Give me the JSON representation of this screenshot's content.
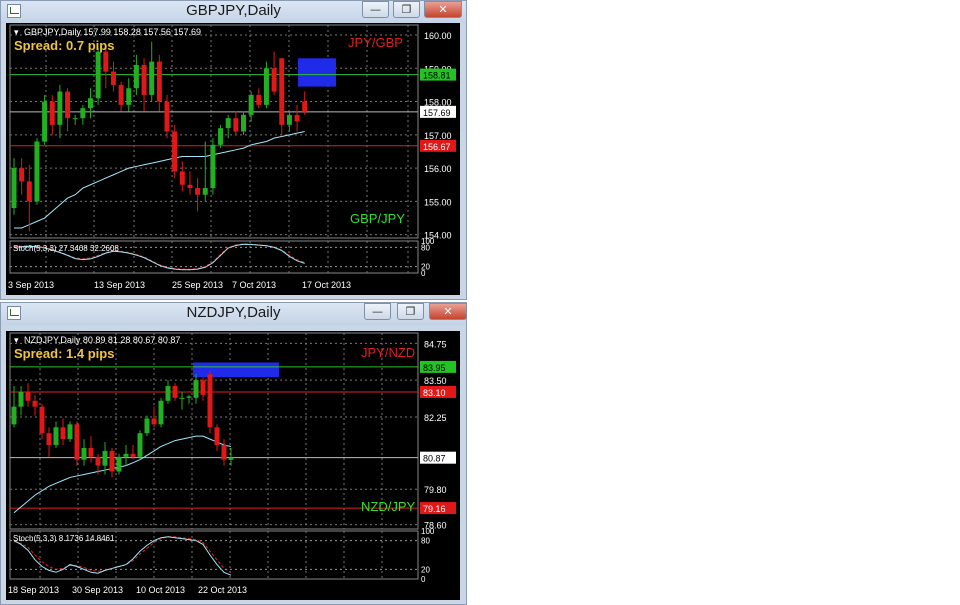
{
  "windows": [
    {
      "id": "gbpjpy",
      "title": "GBPJPY,Daily",
      "buttons": {
        "minimize": "—",
        "maximize": "❐",
        "close": "✕"
      },
      "header": "GBPJPY,Daily  157.99 158.28 157.56 157.69",
      "spread": "Spread: 0.7 pips",
      "label_red": "JPY/GBP",
      "label_green": "GBP/JPY",
      "price_levels": [
        "160.00",
        "159.00",
        "158.00",
        "157.00",
        "156.00",
        "155.00",
        "154.00"
      ],
      "ymin": 153.9,
      "ymax": 160.3,
      "green_line": {
        "value": 158.81,
        "label": "158.81"
      },
      "red_line": {
        "value": 156.67,
        "label": "156.67"
      },
      "current": {
        "value": 157.69,
        "label": "157.69"
      },
      "stoch_label": "Stoch(5,3,3) 27.3408 32.2608",
      "stoch_ticks": [
        "100",
        "80",
        "20",
        "0"
      ],
      "dates": [
        "3 Sep 2013",
        "13 Sep 2013",
        "25 Sep 2013",
        "7 Oct 2013",
        "17 Oct 2013"
      ],
      "candles": [
        [
          154.8,
          156.3,
          154.6,
          156.0
        ],
        [
          156.0,
          156.3,
          155.2,
          155.6
        ],
        [
          155.6,
          156.1,
          154.1,
          155.0
        ],
        [
          155.0,
          156.9,
          154.9,
          156.8
        ],
        [
          156.8,
          158.2,
          156.7,
          158.0
        ],
        [
          158.0,
          158.2,
          157.0,
          157.3
        ],
        [
          157.3,
          158.5,
          156.9,
          158.3
        ],
        [
          158.3,
          158.4,
          157.1,
          157.5
        ],
        [
          157.5,
          157.6,
          157.3,
          157.5
        ],
        [
          157.5,
          157.9,
          157.3,
          157.8
        ],
        [
          157.8,
          158.4,
          157.5,
          158.1
        ],
        [
          158.1,
          159.6,
          157.9,
          159.5
        ],
        [
          159.5,
          159.6,
          158.4,
          158.9
        ],
        [
          158.9,
          159.2,
          158.3,
          158.5
        ],
        [
          158.5,
          158.6,
          157.7,
          157.9
        ],
        [
          157.9,
          158.7,
          157.7,
          158.4
        ],
        [
          158.4,
          159.4,
          158.2,
          159.1
        ],
        [
          159.1,
          159.3,
          157.7,
          158.2
        ],
        [
          158.2,
          159.8,
          158.0,
          159.2
        ],
        [
          159.2,
          159.4,
          157.7,
          158.0
        ],
        [
          158.0,
          158.2,
          156.9,
          157.1
        ],
        [
          157.1,
          157.3,
          155.7,
          155.9
        ],
        [
          155.9,
          156.2,
          155.3,
          155.5
        ],
        [
          155.5,
          155.9,
          155.2,
          155.4
        ],
        [
          155.4,
          155.7,
          154.7,
          155.2
        ],
        [
          155.2,
          156.8,
          155.0,
          155.4
        ],
        [
          155.4,
          156.9,
          155.2,
          156.7
        ],
        [
          156.7,
          157.3,
          156.6,
          157.2
        ],
        [
          157.2,
          157.6,
          156.9,
          157.5
        ],
        [
          157.5,
          157.7,
          157.0,
          157.1
        ],
        [
          157.1,
          157.7,
          157.0,
          157.6
        ],
        [
          157.6,
          158.3,
          157.4,
          158.2
        ],
        [
          158.2,
          158.4,
          157.8,
          157.9
        ],
        [
          157.9,
          159.2,
          157.8,
          159.0
        ],
        [
          159.0,
          159.5,
          158.2,
          158.3
        ],
        [
          159.3,
          159.3,
          157.0,
          157.3
        ],
        [
          157.3,
          157.7,
          157.1,
          157.6
        ],
        [
          157.6,
          157.9,
          157.1,
          157.4
        ],
        [
          158.0,
          158.3,
          157.6,
          157.69
        ]
      ],
      "ma": [
        154.2,
        154.2,
        154.3,
        154.4,
        154.5,
        154.7,
        154.9,
        155.1,
        155.2,
        155.4,
        155.5,
        155.6,
        155.7,
        155.8,
        155.9,
        156.0,
        156.05,
        156.1,
        156.15,
        156.2,
        156.25,
        156.3,
        156.35,
        156.35,
        156.35,
        156.35,
        156.4,
        156.45,
        156.5,
        156.55,
        156.6,
        156.7,
        156.75,
        156.8,
        156.9,
        156.95,
        157.0,
        157.05,
        157.1
      ],
      "stoch_k": [
        80,
        82,
        84,
        82,
        78,
        72,
        64,
        55,
        45,
        42,
        44,
        52,
        62,
        68,
        66,
        62,
        56,
        48,
        36,
        24,
        16,
        12,
        10,
        10,
        12,
        18,
        32,
        55,
        78,
        86,
        90,
        89,
        87,
        85,
        80,
        70,
        52,
        38,
        30
      ],
      "stoch_d": [
        82,
        84,
        86,
        85,
        80,
        74,
        66,
        56,
        47,
        44,
        47,
        55,
        64,
        70,
        68,
        64,
        58,
        50,
        38,
        26,
        18,
        14,
        12,
        12,
        14,
        20,
        34,
        58,
        80,
        88,
        91,
        90,
        88,
        86,
        82,
        72,
        55,
        42,
        33
      ]
    },
    {
      "id": "nzdjpy",
      "title": "NZDJPY,Daily",
      "buttons": {
        "minimize": "—",
        "maximize": "❐",
        "close": "✕"
      },
      "header": "NZDJPY,Daily  80.89 81.28 80.67 80.87",
      "spread": "Spread: 1.4 pips",
      "label_red": "JPY/NZD",
      "label_green": "NZD/JPY",
      "price_levels": [
        "84.75",
        "83.50",
        "82.25",
        "79.80",
        "78.60"
      ],
      "ymin": 78.45,
      "ymax": 85.1,
      "green_line": {
        "value": 83.95,
        "label": "83.95"
      },
      "red_line": {
        "value": 83.1,
        "label": "83.10"
      },
      "red_line2": {
        "value": 79.16,
        "label": "79.16"
      },
      "current": {
        "value": 80.87,
        "label": "80.87"
      },
      "stoch_label": "Stoch(5,3,3) 8.1736 14.8461",
      "stoch_ticks": [
        "100",
        "80",
        "20",
        "0"
      ],
      "dates": [
        "18 Sep 2013",
        "30 Sep 2013",
        "10 Oct 2013",
        "22 Oct 2013"
      ],
      "candles": [
        [
          82.0,
          83.3,
          81.9,
          82.6
        ],
        [
          82.6,
          83.3,
          82.3,
          83.1
        ],
        [
          83.1,
          83.4,
          82.6,
          82.8
        ],
        [
          82.8,
          83.0,
          82.3,
          82.6
        ],
        [
          82.6,
          82.7,
          81.5,
          81.7
        ],
        [
          81.7,
          81.9,
          80.9,
          81.3
        ],
        [
          81.3,
          82.1,
          81.2,
          81.9
        ],
        [
          81.9,
          82.2,
          81.3,
          81.5
        ],
        [
          81.5,
          82.1,
          81.4,
          82.0
        ],
        [
          82.0,
          82.1,
          80.6,
          80.8
        ],
        [
          80.8,
          81.5,
          80.6,
          81.2
        ],
        [
          81.2,
          81.6,
          80.7,
          80.9
        ],
        [
          80.9,
          81.0,
          80.3,
          80.6
        ],
        [
          80.6,
          81.4,
          80.3,
          81.1
        ],
        [
          81.1,
          81.2,
          80.2,
          80.4
        ],
        [
          80.4,
          81.0,
          80.3,
          80.9
        ],
        [
          80.9,
          81.3,
          80.6,
          81.0
        ],
        [
          81.0,
          81.3,
          80.8,
          80.9
        ],
        [
          80.9,
          81.8,
          80.8,
          81.7
        ],
        [
          81.7,
          82.3,
          81.6,
          82.2
        ],
        [
          82.2,
          82.6,
          81.9,
          82.0
        ],
        [
          82.0,
          82.9,
          81.9,
          82.8
        ],
        [
          82.8,
          83.5,
          82.7,
          83.3
        ],
        [
          83.3,
          83.4,
          82.8,
          82.9
        ],
        [
          82.9,
          83.1,
          82.5,
          82.9
        ],
        [
          82.9,
          83.0,
          82.7,
          82.95
        ],
        [
          82.9,
          83.7,
          82.7,
          83.5
        ],
        [
          83.5,
          83.6,
          82.8,
          83.0
        ],
        [
          83.7,
          83.8,
          81.7,
          81.9
        ],
        [
          81.9,
          82.0,
          81.1,
          81.3
        ],
        [
          81.3,
          81.5,
          80.6,
          80.8
        ],
        [
          80.8,
          81.2,
          80.6,
          80.87
        ]
      ],
      "ma": [
        79.0,
        79.2,
        79.4,
        79.6,
        79.75,
        79.9,
        80.0,
        80.1,
        80.2,
        80.25,
        80.3,
        80.35,
        80.4,
        80.45,
        80.5,
        80.55,
        80.6,
        80.7,
        80.8,
        80.95,
        81.1,
        81.25,
        81.35,
        81.45,
        81.5,
        81.55,
        81.6,
        81.6,
        81.5,
        81.4,
        81.3,
        81.25
      ],
      "stoch_k": [
        80,
        72,
        60,
        40,
        26,
        18,
        14,
        20,
        30,
        26,
        20,
        14,
        12,
        18,
        22,
        26,
        30,
        42,
        58,
        70,
        80,
        86,
        88,
        86,
        84,
        82,
        80,
        72,
        50,
        30,
        14,
        8
      ],
      "stoch_d": [
        78,
        74,
        66,
        50,
        36,
        26,
        20,
        22,
        28,
        28,
        24,
        18,
        16,
        18,
        22,
        26,
        30,
        38,
        52,
        64,
        76,
        84,
        88,
        88,
        86,
        84,
        82,
        76,
        58,
        40,
        22,
        14
      ]
    }
  ]
}
